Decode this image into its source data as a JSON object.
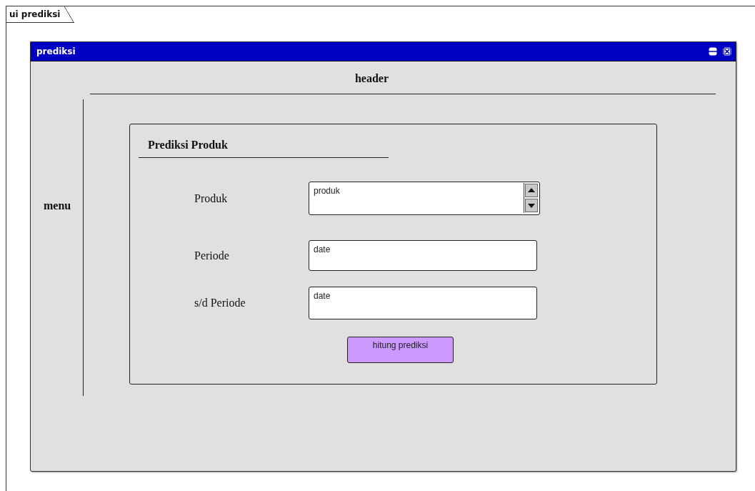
{
  "frame": {
    "title": "ui prediksi"
  },
  "window": {
    "title": "prediksi"
  },
  "header": "header",
  "menu": "menu",
  "panel": {
    "title": "Prediksi Produk",
    "fields": [
      {
        "label": "Produk",
        "kind": "spinner",
        "value": "produk"
      },
      {
        "label": "Periode",
        "kind": "text",
        "value": "date"
      },
      {
        "label": "s/d Periode",
        "kind": "text",
        "value": "date"
      }
    ],
    "button": "hitung prediksi"
  }
}
